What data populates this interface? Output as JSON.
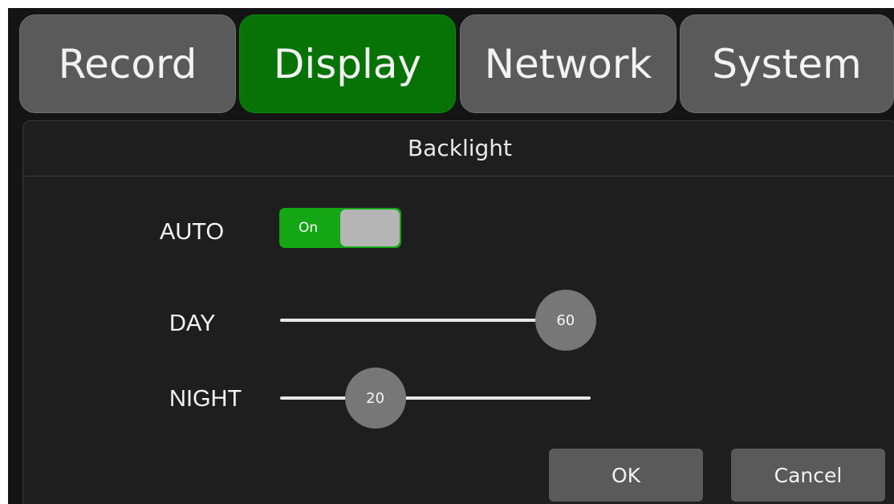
{
  "tabs": {
    "record": "Record",
    "display": "Display",
    "network": "Network",
    "system": "System",
    "active": "display"
  },
  "panel": {
    "title": "Backlight",
    "auto": {
      "label": "AUTO",
      "toggle_text": "On",
      "enabled": true
    },
    "day": {
      "label": "DAY",
      "value": "60",
      "fraction": 0.6
    },
    "night": {
      "label": "NIGHT",
      "value": "20",
      "fraction": 0.2
    },
    "buttons": {
      "ok": "OK",
      "cancel": "Cancel"
    }
  },
  "colors": {
    "active_tab": "#077307",
    "inactive_tab": "#5a5a5a",
    "toggle_on": "#14a614",
    "background": "#141414",
    "panel": "#1e1e1e"
  }
}
